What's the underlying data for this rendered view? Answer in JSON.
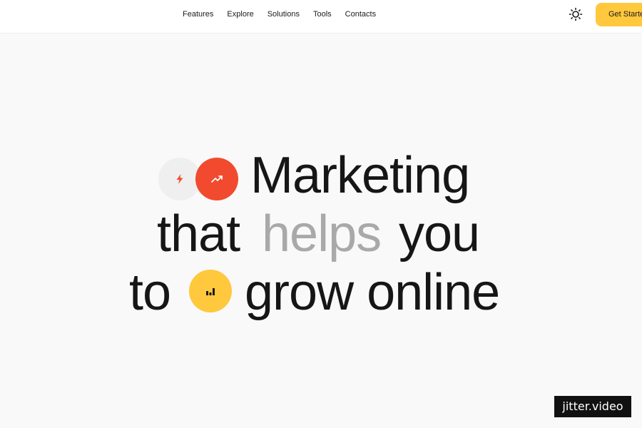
{
  "nav": {
    "items": [
      {
        "label": "Features"
      },
      {
        "label": "Explore"
      },
      {
        "label": "Solutions"
      },
      {
        "label": "Tools"
      },
      {
        "label": "Contacts"
      }
    ]
  },
  "header": {
    "theme_icon": "sun-icon",
    "cta_label": "Get Started"
  },
  "hero": {
    "line1": {
      "word": "Marketing"
    },
    "line2": {
      "word1": "that",
      "word2": "helps",
      "word3": "you"
    },
    "line3": {
      "word1": "to",
      "word2": "grow online"
    },
    "icons": {
      "gray_badge": "lightning-icon",
      "red_badge": "trending-up-icon",
      "yellow_badge": "bar-chart-icon"
    }
  },
  "watermark": {
    "text": "jitter.video"
  },
  "colors": {
    "page_bg": "#f9f9f9",
    "header_bg": "#ffffff",
    "accent_yellow": "#ffc83d",
    "accent_red": "#f24a2e",
    "text_dark": "#161616",
    "text_muted": "#a9a9a9"
  }
}
